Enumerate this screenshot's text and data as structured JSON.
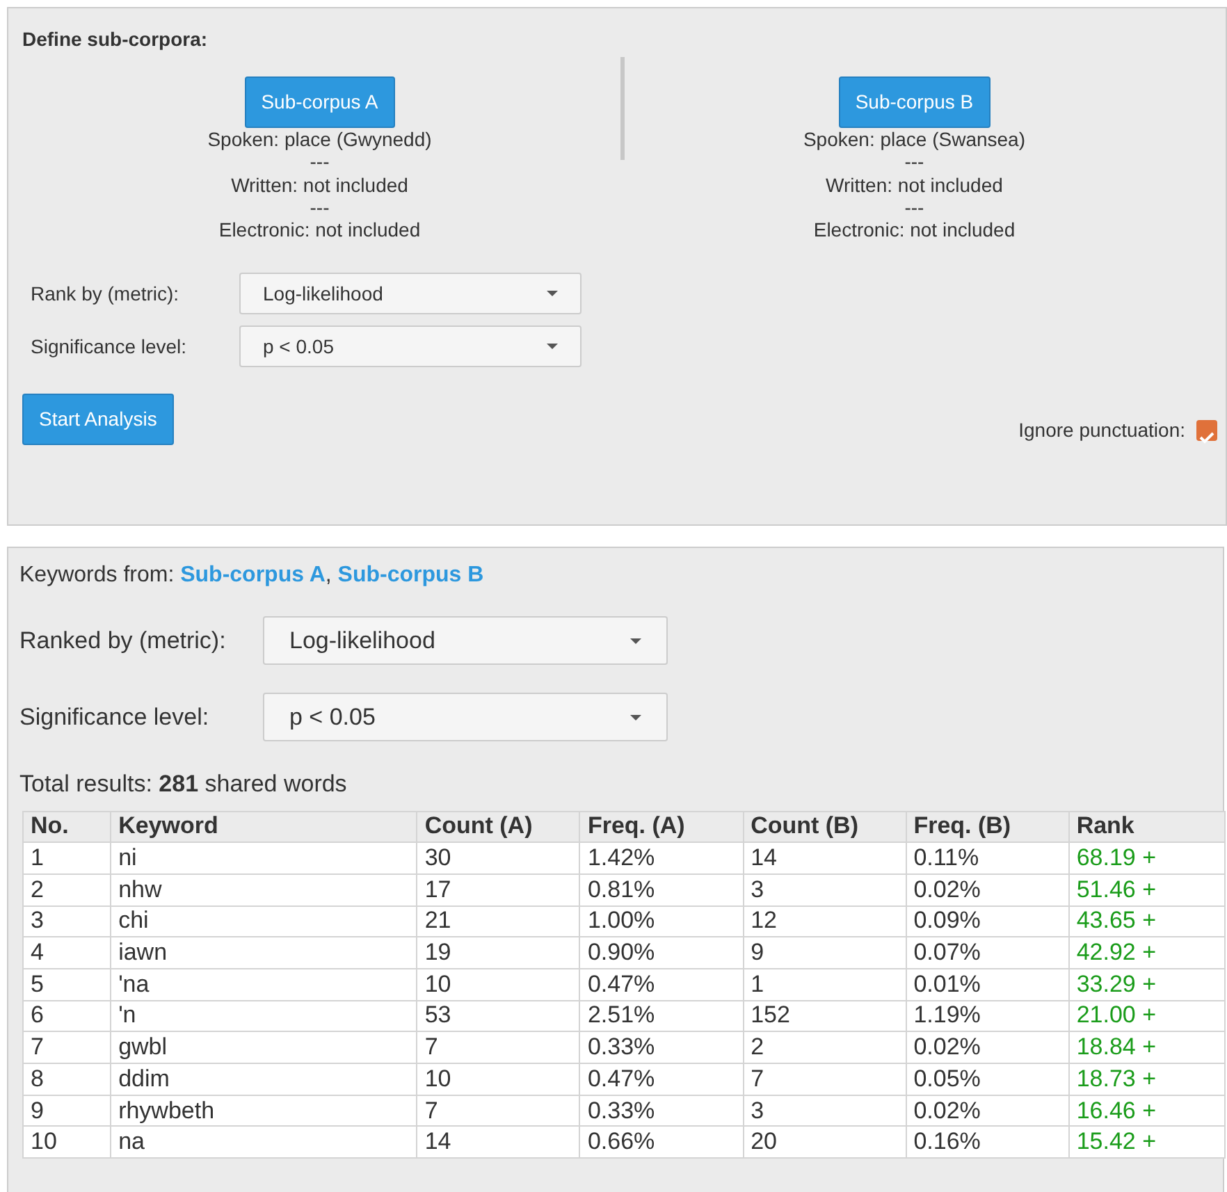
{
  "define_panel": {
    "title": "Define sub-corpora:",
    "subcorpora": [
      {
        "button": "Sub-corpus A",
        "lines": [
          "Spoken: place (Gwynedd)",
          "---",
          "Written: not included",
          "---",
          "Electronic: not included"
        ]
      },
      {
        "button": "Sub-corpus B",
        "lines": [
          "Spoken: place (Swansea)",
          "---",
          "Written: not included",
          "---",
          "Electronic: not included"
        ]
      }
    ],
    "selects": [
      {
        "label": "Rank by (metric):",
        "value": "Log-likelihood"
      },
      {
        "label": "Significance level:",
        "value": "p < 0.05"
      }
    ],
    "start_button": "Start Analysis",
    "ignore_punctuation": {
      "label": "Ignore punctuation:",
      "checked": true
    }
  },
  "results_panel": {
    "keywords_from": {
      "label": "Keywords from:",
      "links": [
        "Sub-corpus A",
        "Sub-corpus B"
      ],
      "separator": ","
    },
    "selects": [
      {
        "label": "Ranked by (metric):",
        "value": "Log-likelihood"
      },
      {
        "label": "Significance level:",
        "value": "p < 0.05"
      }
    ],
    "total": "Total results: **281** shared words",
    "table": {
      "columns": [
        "No.",
        "Keyword",
        "Count (A)",
        "Freq. (A)",
        "Count (B)",
        "Freq. (B)",
        "Rank"
      ],
      "rows": [
        [
          "1",
          "ni",
          "30",
          "1.42%",
          "14",
          "0.11%",
          "68.19 +"
        ],
        [
          "2",
          "nhw",
          "17",
          "0.81%",
          "3",
          "0.02%",
          "51.46 +"
        ],
        [
          "3",
          "chi",
          "21",
          "1.00%",
          "12",
          "0.09%",
          "43.65 +"
        ],
        [
          "4",
          "iawn",
          "19",
          "0.90%",
          "9",
          "0.07%",
          "42.92 +"
        ],
        [
          "5",
          "'na",
          "10",
          "0.47%",
          "1",
          "0.01%",
          "33.29 +"
        ],
        [
          "6",
          "'n",
          "53",
          "2.51%",
          "152",
          "1.19%",
          "21.00 +"
        ],
        [
          "7",
          "gwbl",
          "7",
          "0.33%",
          "2",
          "0.02%",
          "18.84 +"
        ],
        [
          "8",
          "ddim",
          "10",
          "0.47%",
          "7",
          "0.05%",
          "18.73 +"
        ],
        [
          "9",
          "rhywbeth",
          "7",
          "0.33%",
          "3",
          "0.02%",
          "16.46 +"
        ],
        [
          "10",
          "na",
          "14",
          "0.66%",
          "20",
          "0.16%",
          "15.42 +"
        ]
      ]
    }
  }
}
